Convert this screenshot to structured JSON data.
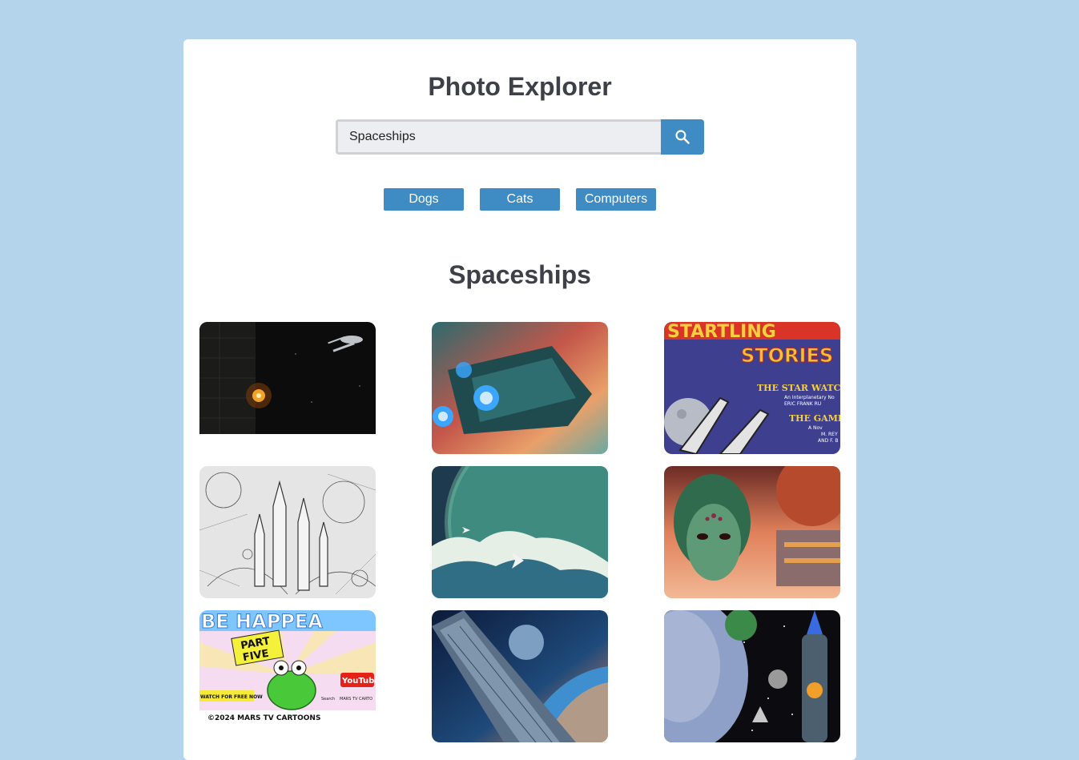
{
  "page": {
    "title": "Photo Explorer",
    "background_color": "#b3d4ea",
    "accent_color": "#3f8bc3"
  },
  "search": {
    "value": "Spaceships",
    "button_icon": "search-icon"
  },
  "categories": [
    "Dogs",
    "Cats",
    "Computers"
  ],
  "results": {
    "heading": "Spaceships",
    "images": [
      {
        "name": "dark-space-battle-photo"
      },
      {
        "name": "teal-spaceship-nebula-photo"
      },
      {
        "name": "startling-stories-cover-photo",
        "text": [
          "STARTLING",
          "STORIES",
          "THE STAR WATCH",
          "An Interplanetary No",
          "ERIC FRANK RU",
          "THE GAMBL",
          "A Nov",
          "M. REY",
          "AND F. B"
        ]
      },
      {
        "name": "sketch-rockets-photo"
      },
      {
        "name": "planet-clouds-jets-photo"
      },
      {
        "name": "alien-medusa-city-photo"
      },
      {
        "name": "mars-tv-cartoon-photo",
        "text": [
          "BE HAPPEA",
          "PART",
          "FIVE",
          "WATCH FOR FREE NOW",
          "YouTube",
          "Search",
          "MARS TV CARTO",
          "©2024 MARS TV CARTOONS"
        ]
      },
      {
        "name": "space-station-planet-photo"
      },
      {
        "name": "retro-rocket-planets-photo"
      }
    ]
  }
}
